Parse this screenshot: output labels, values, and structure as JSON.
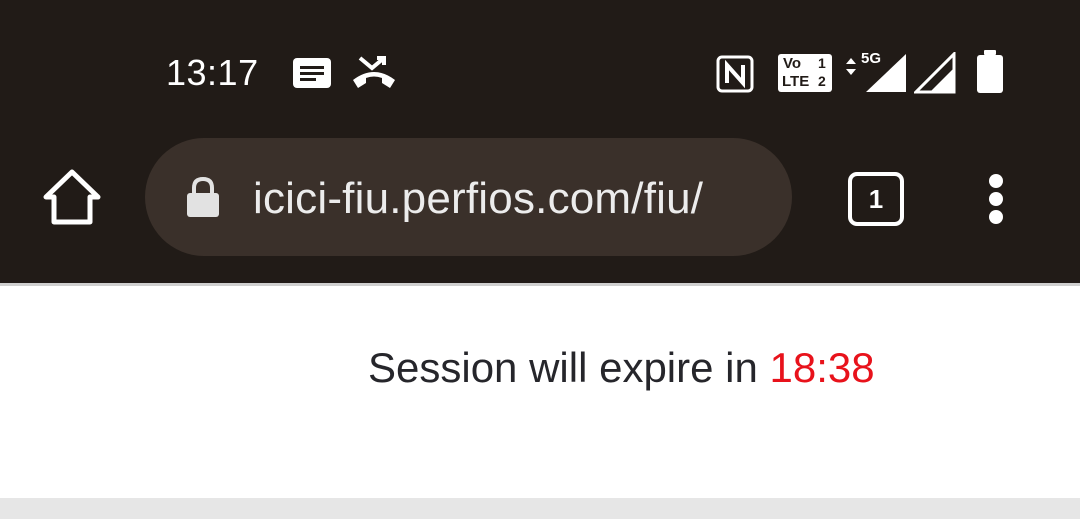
{
  "status_bar": {
    "time": "13:17",
    "icons": [
      "notes-icon",
      "missed-call-icon",
      "nfc-icon",
      "volte-icon",
      "5g-signal-icon",
      "signal-icon",
      "battery-icon"
    ],
    "volte_text_top": "Vo",
    "volte_text_bottom": "LTE",
    "sim1": "1",
    "sim2": "2",
    "network": "5G"
  },
  "toolbar": {
    "url": "icici-fiu.perfios.com/fiu/",
    "tab_count": "1"
  },
  "page": {
    "session_label": "Session will expire in",
    "session_timer": "18:38"
  },
  "colors": {
    "chrome_bg": "#211b17",
    "omnibox_bg": "#3a302a",
    "timer": "#e8121b"
  }
}
